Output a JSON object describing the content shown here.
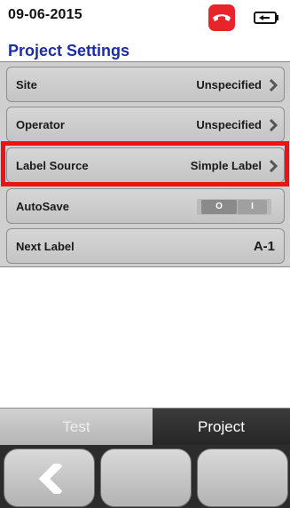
{
  "status": {
    "date": "09-06-2015",
    "icons": [
      "phone-hangup-icon",
      "battery-icon"
    ],
    "accent_color": "#e8232a"
  },
  "page": {
    "title": "Project Settings",
    "title_color": "#1c2ea0"
  },
  "settings": [
    {
      "label": "Site",
      "value": "Unspecified"
    },
    {
      "label": "Operator",
      "value": "Unspecified"
    },
    {
      "label": "Label Source",
      "value": "Simple Label",
      "highlighted": true
    },
    {
      "label": "AutoSave",
      "toggle_off": "O",
      "toggle_on": "I",
      "state": "off"
    },
    {
      "label": "Next Label",
      "value": "A-1"
    }
  ],
  "highlight_color": "#ee1313",
  "tabs": [
    {
      "label": "Test",
      "active": false
    },
    {
      "label": "Project",
      "active": true
    }
  ],
  "softkeys": {
    "icons": [
      "back-chevron-icon"
    ]
  }
}
